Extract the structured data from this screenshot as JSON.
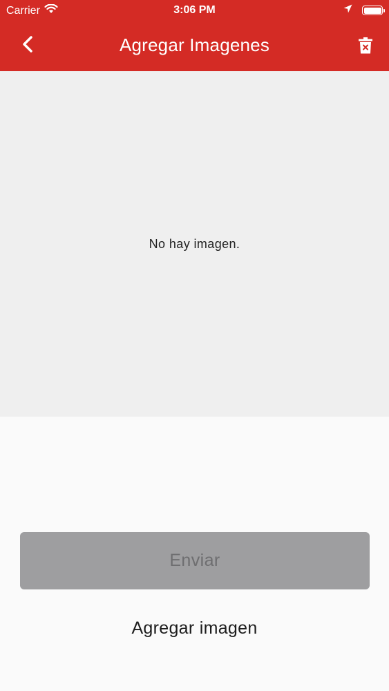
{
  "status_bar": {
    "carrier": "Carrier",
    "time": "3:06 PM"
  },
  "nav": {
    "title": "Agregar Imagenes",
    "back_icon": "chevron-left-icon",
    "delete_icon": "trash-x-icon"
  },
  "image_area": {
    "empty_text": "No hay imagen."
  },
  "actions": {
    "send_label": "Enviar",
    "add_image_label": "Agregar imagen"
  },
  "colors": {
    "header": "#d42b25",
    "image_area": "#efefef",
    "send_button_bg": "#9e9ea0",
    "send_button_text": "#6e6e70"
  }
}
